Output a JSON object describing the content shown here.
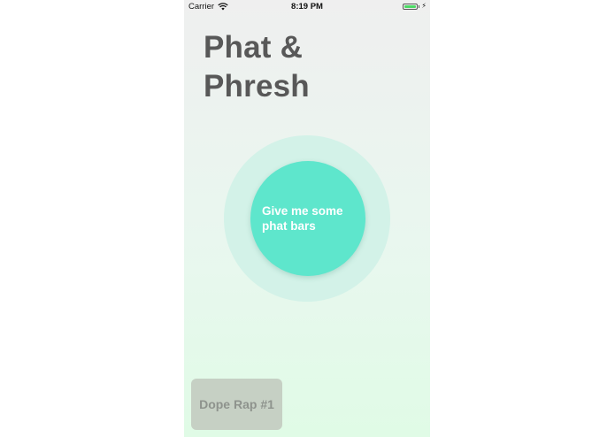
{
  "status_bar": {
    "carrier": "Carrier",
    "time": "8:19 PM",
    "battery_color": "#4cd964",
    "icons": [
      "wifi-icon",
      "battery-icon",
      "bolt-icon"
    ]
  },
  "header": {
    "title": "Phat &\nPhresh"
  },
  "main": {
    "generate_button_label": "Give me some phat bars",
    "accent_color": "#5ee6cc"
  },
  "saved_raps": [
    {
      "label": "Dope Rap #1"
    }
  ]
}
